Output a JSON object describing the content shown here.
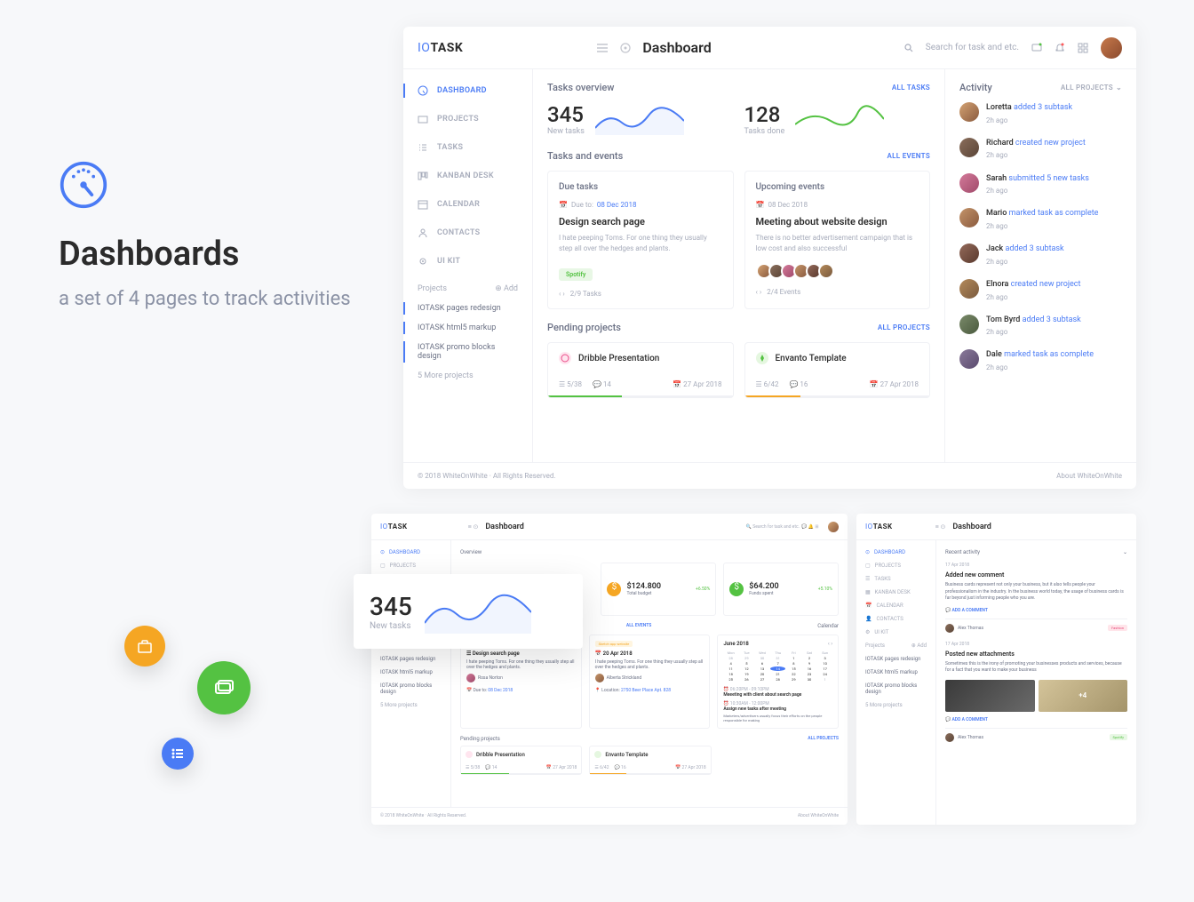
{
  "promo": {
    "title": "Dashboards",
    "subtitle": "a set of 4 pages to track activities"
  },
  "header": {
    "logo_io": "IO",
    "logo_task": "TASK",
    "page_title": "Dashboard",
    "search_placeholder": "Search for task and etc."
  },
  "sidebar": {
    "items": [
      {
        "label": "DASHBOARD"
      },
      {
        "label": "PROJECTS"
      },
      {
        "label": "TASKS"
      },
      {
        "label": "KANBAN DESK"
      },
      {
        "label": "CALENDAR"
      },
      {
        "label": "CONTACTS"
      },
      {
        "label": "UI KIT"
      }
    ],
    "projects_label": "Projects",
    "add_label": "⊕ Add",
    "projects": [
      {
        "label": "IOTASK pages redesign"
      },
      {
        "label": "IOTASK html5 markup"
      },
      {
        "label": "IOTASK promo blocks design"
      }
    ],
    "more": "5 More projects"
  },
  "content": {
    "tasks_overview": "Tasks overview",
    "all_tasks": "ALL TASKS",
    "stat_new": "345",
    "stat_new_label": "New tasks",
    "stat_done": "128",
    "stat_done_label": "Tasks done",
    "tasks_events": "Tasks and events",
    "all_events": "ALL EVENTS",
    "due_tasks": {
      "title": "Due tasks",
      "due_prefix": "Due to:",
      "due_date": "08 Dec 2018",
      "heading": "Design search page",
      "body": "I hate peeping Toms. For one thing they usually step all over the hedges and plants.",
      "tag": "Spotify",
      "nav": "2/9 Tasks"
    },
    "upcoming": {
      "title": "Upcoming events",
      "date": "08 Dec 2018",
      "heading": "Meeting about website design",
      "body": "There is no better advertisement campaign that is low cost and also successful",
      "nav": "2/4 Events"
    },
    "pending_label": "Pending projects",
    "all_projects": "ALL PROJECTS",
    "pending": [
      {
        "name": "Dribble Presentation",
        "tasks": "5/38",
        "comments": "14",
        "date": "27 Apr 2018",
        "color": "#54c242",
        "pct": 40
      },
      {
        "name": "Envanto Template",
        "tasks": "6/42",
        "comments": "16",
        "date": "27 Apr 2018",
        "color": "#f5a623",
        "pct": 30
      }
    ]
  },
  "activity": {
    "title": "Activity",
    "filter": "ALL PROJECTS",
    "items": [
      {
        "name": "Loretta",
        "action": "added 3 subtask",
        "time": "2h ago"
      },
      {
        "name": "Richard",
        "action": "created new project",
        "time": "2h ago"
      },
      {
        "name": "Sarah",
        "action": "submitted 5 new tasks",
        "time": "2h ago"
      },
      {
        "name": "Mario",
        "action": "marked task as complete",
        "time": "2h ago"
      },
      {
        "name": "Jack",
        "action": "added 3 subtask",
        "time": "2h ago"
      },
      {
        "name": "Elnora",
        "action": "created new project",
        "time": "2h ago"
      },
      {
        "name": "Tom Byrd",
        "action": "added 3 subtask",
        "time": "2h ago"
      },
      {
        "name": "Dale",
        "action": "marked task as complete",
        "time": "2h ago"
      }
    ]
  },
  "footer": {
    "copyright": "© 2018 WhiteOnWhite · All Rights Reserved.",
    "about": "About WhiteOnWhite"
  },
  "overlay": {
    "num": "345",
    "label": "New tasks"
  },
  "mini2": {
    "overview": "Overview",
    "budget1": "$124.800",
    "budget1_label": "Total budget",
    "budget1_pct": "+6.50%",
    "budget2": "$64.200",
    "budget2_label": "Funds spent",
    "budget2_pct": "+5.10%",
    "calendar": "Calendar",
    "cal_month": "June 2018",
    "task_title": "Design search page",
    "task_date": "08 Dec 2018",
    "task_person1": "Rosa Norton",
    "event_date": "20 Apr 2018",
    "event_person": "Alberta Strickland",
    "event_loc": "2750 Beer Place Apt. 828",
    "meeting": "Meeeting with client about search page",
    "assign": "Assign new tasks after meeting",
    "pending": "Pending projects",
    "all_events": "ALL EVENTS",
    "all_projects": "ALL PROJECTS"
  },
  "mini3": {
    "recent": "Recent activity",
    "date": "17 Apr 2018",
    "comment_title": "Added new comment",
    "comment_body": "Business cards represent not only your business, but it also tells people your professionalism in the industry. In the business world today, the usage of business cards is far beyond just informing people who you are.",
    "add_comment": "ADD A COMMENT",
    "author": "Alex Thomas",
    "attach_title": "Posted new attachments",
    "attach_body": "Sometimes this is the irony of promoting your businesses products and services, because for a fact that you want to make your business",
    "plus4": "+4",
    "tag": "Spotify",
    "tag2": "Fashion"
  }
}
